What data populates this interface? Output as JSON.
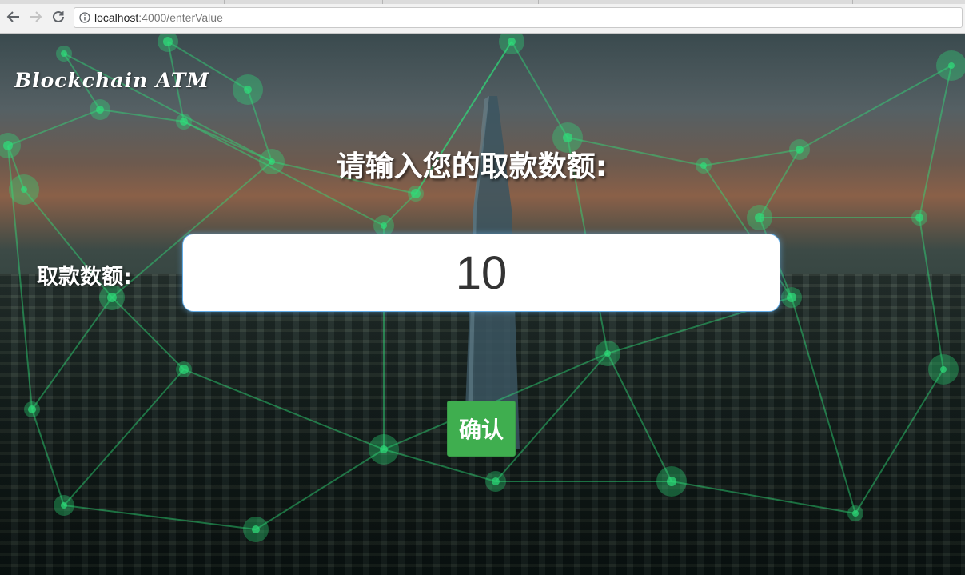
{
  "browser": {
    "url_host": "localhost",
    "url_rest": ":4000/enterValue"
  },
  "page": {
    "logo": "Blockchain ATM",
    "heading": "请输入您的取款数额:",
    "amount_label": "取款数额:",
    "amount_value": "10",
    "confirm_label": "确认"
  },
  "colors": {
    "confirm_button": "#3fae4f",
    "input_focus_border": "#66afe9",
    "network_glow": "#2ee07a"
  },
  "icons": [
    "back-arrow-icon",
    "forward-arrow-icon",
    "reload-icon",
    "info-icon"
  ]
}
